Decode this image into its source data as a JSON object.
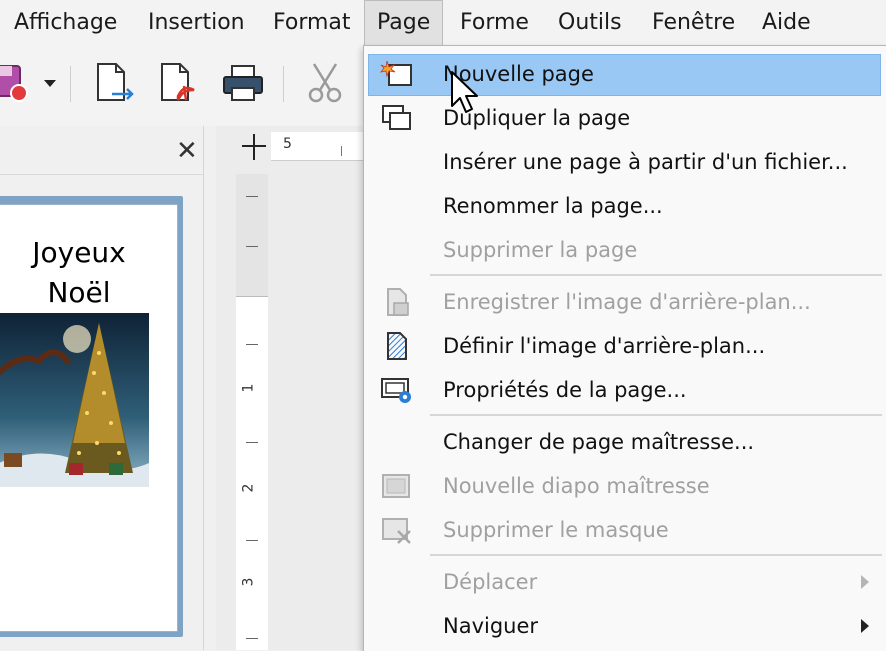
{
  "menubar": {
    "items": [
      {
        "label": "Affichage"
      },
      {
        "label": "Insertion"
      },
      {
        "label": "Format"
      },
      {
        "label": "Page"
      },
      {
        "label": "Forme"
      },
      {
        "label": "Outils"
      },
      {
        "label": "Fenêtre"
      },
      {
        "label": "Aide"
      }
    ]
  },
  "slide_panel": {
    "close_glyph": "✕",
    "thumbnail_title_line1": "Joyeux",
    "thumbnail_title_line2": "Noël"
  },
  "ruler": {
    "h_label": "5",
    "v_labels": [
      "1",
      "2",
      "3"
    ]
  },
  "page_menu": {
    "items": [
      {
        "label": "Nouvelle page",
        "icon": "new-page-icon",
        "enabled": true,
        "highlighted": true
      },
      {
        "label": "Dupliquer la page",
        "icon": "duplicate-page-icon",
        "enabled": true
      },
      {
        "label": "Insérer une page à partir d'un fichier...",
        "enabled": true
      },
      {
        "label": "Renommer la page...",
        "enabled": true
      },
      {
        "label": "Supprimer la page",
        "enabled": false
      },
      {
        "label": "Enregistrer l'image d'arrière-plan...",
        "icon": "save-background-icon",
        "enabled": false
      },
      {
        "label": "Définir l'image d'arrière-plan...",
        "icon": "set-background-icon",
        "enabled": true
      },
      {
        "label": "Propriétés de la page...",
        "icon": "page-properties-icon",
        "enabled": true
      },
      {
        "label": "Changer de page maîtresse...",
        "enabled": true
      },
      {
        "label": "Nouvelle diapo maîtresse",
        "icon": "new-master-slide-icon",
        "enabled": false
      },
      {
        "label": "Supprimer le masque",
        "icon": "delete-master-icon",
        "enabled": false
      },
      {
        "label": "Déplacer",
        "enabled": false,
        "submenu": true
      },
      {
        "label": "Naviguer",
        "enabled": true,
        "submenu": true
      }
    ]
  },
  "colors": {
    "highlight": "#99c8f5",
    "disabled_text": "#a0a0a0",
    "pdf_red": "#d9342b",
    "arrow_blue": "#2a7fd4"
  }
}
